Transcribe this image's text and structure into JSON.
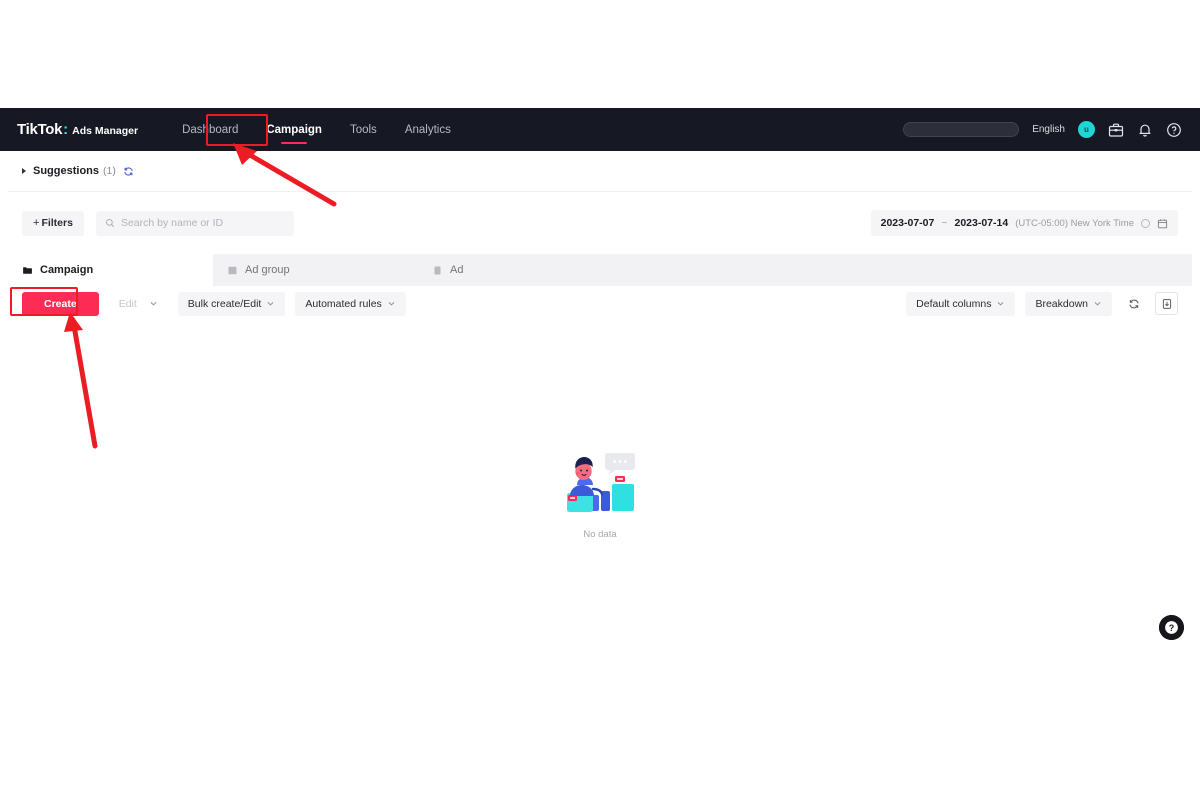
{
  "header": {
    "brand_name": "TikTok",
    "brand_separator": ":",
    "brand_suffix": "Ads Manager",
    "nav": [
      {
        "label": "Dashboard",
        "active": false,
        "name": "nav-item-dashboard"
      },
      {
        "label": "Campaign",
        "active": true,
        "name": "nav-item-campaign"
      },
      {
        "label": "Tools",
        "active": false,
        "name": "nav-item-tools"
      },
      {
        "label": "Analytics",
        "active": false,
        "name": "nav-item-analytics"
      }
    ],
    "account_pill": "",
    "language": "English",
    "avatar_initial": "u",
    "icons": [
      "briefcase-icon",
      "bell-icon",
      "help-circle-icon"
    ],
    "bg_color": "#161823",
    "accent_color": "#fe2c55",
    "avatar_color": "#20d5d5"
  },
  "suggestions": {
    "label": "Suggestions",
    "count": "(1)",
    "refresh_icon": "refresh-icon"
  },
  "filterbar": {
    "filters_plus": "+",
    "filters_label": "Filters",
    "search_placeholder": "Search by name or ID",
    "search_value": "",
    "date_start": "2023-07-07",
    "date_separator": "~",
    "date_end": "2023-07-14",
    "timezone": "(UTC-05:00) New York Time"
  },
  "tabs": [
    {
      "label": "Campaign",
      "icon": "campaign-folder-icon",
      "active": true
    },
    {
      "label": "Ad group",
      "icon": "ad-group-icon",
      "active": false
    },
    {
      "label": "Ad",
      "icon": "ad-icon",
      "active": false
    }
  ],
  "toolbar": {
    "create_label": "Create",
    "edit_label": "Edit",
    "bulk_label": "Bulk create/Edit",
    "automated_label": "Automated rules",
    "columns_label": "Default columns",
    "breakdown_label": "Breakdown",
    "refresh_icon": "refresh-icon",
    "export_icon": "export-icon"
  },
  "content": {
    "empty_text": "No data",
    "illustration": "no-data-illustration"
  },
  "fab": {
    "icon": "help-question-icon"
  },
  "annotations": {
    "color": "#ec1c24",
    "box_nav_target": "Campaign",
    "box_create_target": "Create",
    "arrow_count": 2
  }
}
